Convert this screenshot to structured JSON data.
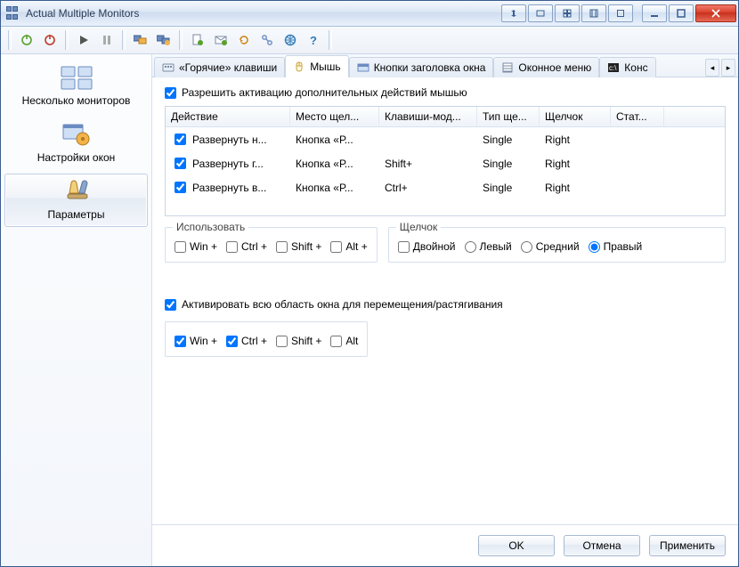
{
  "window": {
    "title": "Actual Multiple Monitors"
  },
  "sidebar": {
    "items": [
      {
        "label": "Несколько мониторов"
      },
      {
        "label": "Настройки окон"
      },
      {
        "label": "Параметры"
      }
    ]
  },
  "tabs": {
    "items": [
      {
        "label": "«Горячие» клавиши"
      },
      {
        "label": "Мышь"
      },
      {
        "label": "Кнопки заголовка окна"
      },
      {
        "label": "Оконное меню"
      },
      {
        "label": "Конс"
      }
    ]
  },
  "page": {
    "enable_extra_mouse": "Разрешить активацию дополнительных действий мышью",
    "columns": {
      "action": "Действие",
      "place": "Место щел...",
      "mods": "Клавиши-мод...",
      "type": "Тип ще...",
      "click": "Щелчок",
      "stat": "Стат..."
    },
    "rows": [
      {
        "action": "Развернуть н...",
        "place": "Кнопка «Р...",
        "mods": "",
        "type": "Single",
        "click": "Right"
      },
      {
        "action": "Развернуть г...",
        "place": "Кнопка «Р...",
        "mods": "Shift+",
        "type": "Single",
        "click": "Right"
      },
      {
        "action": "Развернуть в...",
        "place": "Кнопка «Р...",
        "mods": "Ctrl+",
        "type": "Single",
        "click": "Right"
      }
    ],
    "use_group": {
      "legend": "Использовать",
      "win": "Win +",
      "ctrl": "Ctrl +",
      "shift": "Shift +",
      "alt": "Alt +"
    },
    "click_group": {
      "legend": "Щелчок",
      "double": "Двойной",
      "left": "Левый",
      "middle": "Средний",
      "right": "Правый"
    },
    "activate_drag": "Активировать всю область окна для перемещения/растягивания",
    "drag_mods": {
      "win": "Win +",
      "ctrl": "Ctrl +",
      "shift": "Shift +",
      "alt": "Alt"
    }
  },
  "footer": {
    "ok": "OK",
    "cancel": "Отмена",
    "apply": "Применить"
  }
}
